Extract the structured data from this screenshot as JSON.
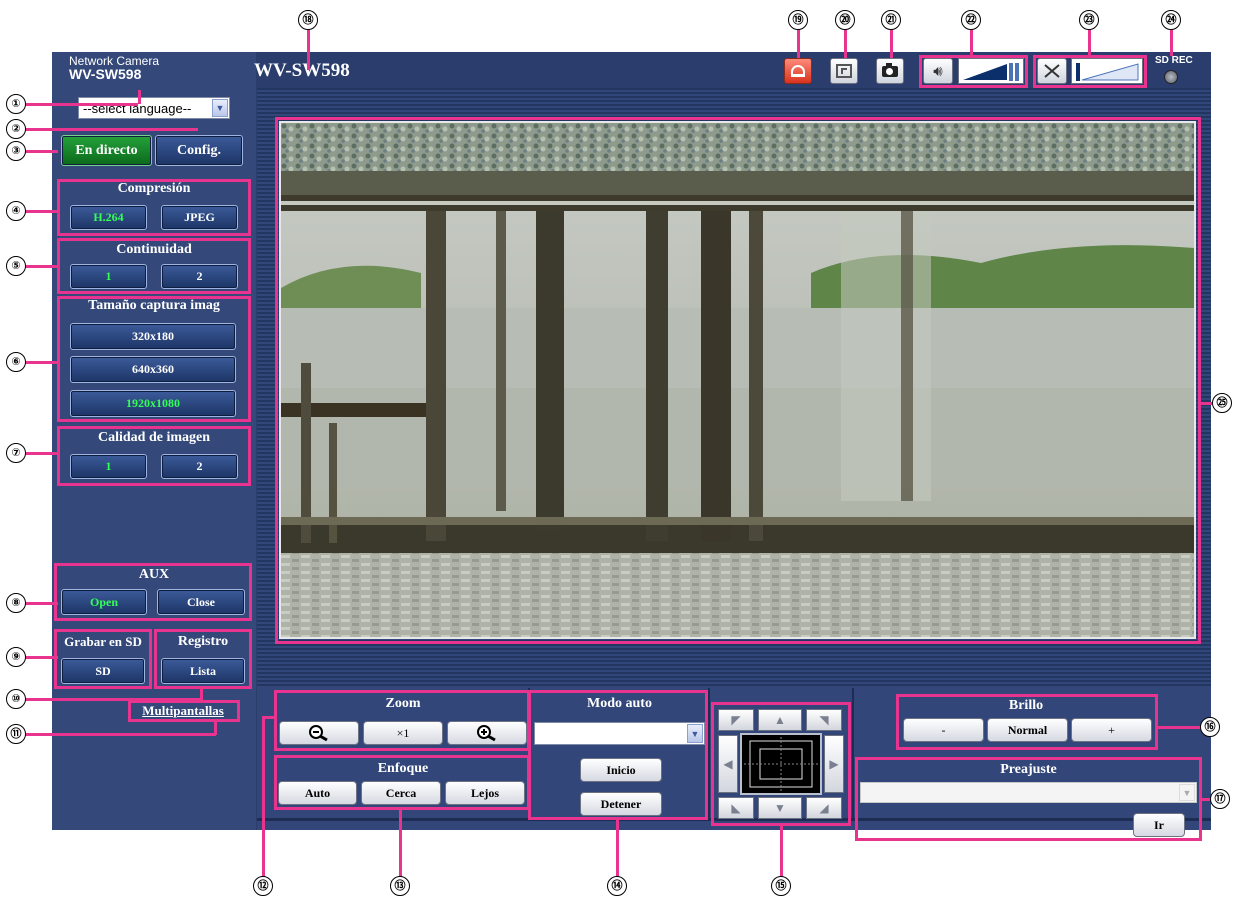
{
  "callouts": [
    "①",
    "②",
    "③",
    "④",
    "⑤",
    "⑥",
    "⑦",
    "⑧",
    "⑨",
    "⑩",
    "⑪",
    "⑫",
    "⑬",
    "⑭",
    "⑮",
    "⑯",
    "⑰",
    "⑱",
    "⑲",
    "⑳",
    "㉑",
    "㉒",
    "㉓",
    "㉔",
    "㉕"
  ],
  "header": {
    "brand_line1": "Network Camera",
    "brand_line2": "WV-SW598",
    "camera_title": "WV-SW598",
    "sd_rec_label": "SD REC"
  },
  "sidebar": {
    "language_select": "--select language--",
    "live_button": "En directo",
    "setup_button": "Config.",
    "compression": {
      "title": "Compresión",
      "h264": "H.264",
      "jpeg": "JPEG"
    },
    "stream": {
      "title": "Continuidad",
      "one": "1",
      "two": "2"
    },
    "capture_size": {
      "title": "Tamaño captura imag",
      "s1": "320x180",
      "s2": "640x360",
      "s3": "1920x1080"
    },
    "image_quality": {
      "title": "Calidad de imagen",
      "one": "1",
      "two": "2"
    },
    "aux": {
      "title": "AUX",
      "open": "Open",
      "close": "Close"
    },
    "sd_record": {
      "title": "Grabar en SD",
      "button": "SD"
    },
    "log": {
      "title": "Registro",
      "button": "Lista"
    },
    "multiscreen_link": "Multipantallas"
  },
  "controls": {
    "zoom": {
      "title": "Zoom",
      "x1": "×1"
    },
    "focus": {
      "title": "Enfoque",
      "auto": "Auto",
      "near": "Cerca",
      "far": "Lejos"
    },
    "auto_mode": {
      "title": "Modo auto",
      "start": "Inicio",
      "stop": "Detener"
    },
    "brightness": {
      "title": "Brillo",
      "minus": "-",
      "normal": "Normal",
      "plus": "+"
    },
    "preset": {
      "title": "Preajuste",
      "go": "Ir"
    }
  },
  "colors": {
    "frame_bg": "#2b3e6b",
    "active_text": "#33ff55",
    "live_green": "#25a13a",
    "annotation_pink": "#e8338f"
  }
}
